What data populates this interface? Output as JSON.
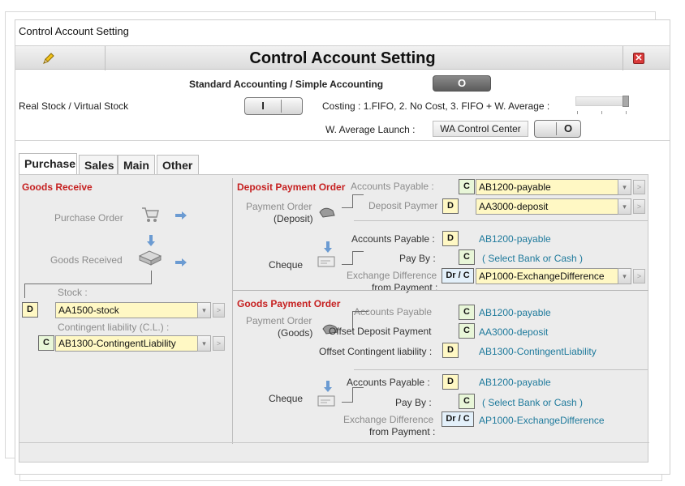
{
  "window": {
    "title": "Control Account Setting"
  },
  "header": {
    "title": "Control Account Setting",
    "pencil_icon": "pencil-icon",
    "close_icon": "close-icon"
  },
  "settings": {
    "accounting_mode_label": "Standard Accounting / Simple Accounting",
    "accounting_mode_value": "O",
    "stock_label": "Real Stock  / Virtual Stock",
    "stock_toggle_value": "I",
    "costing_label": "Costing : 1.FIFO,  2. No Cost,  3. FIFO + W. Average  :",
    "w_average_label": "W. Average Launch :",
    "wa_button": "WA Control Center",
    "w_average_toggle_value": "O"
  },
  "tabs": [
    {
      "label": "Purchase",
      "active": true
    },
    {
      "label": "Sales",
      "active": false
    },
    {
      "label": "Main",
      "active": false
    },
    {
      "label": "Other",
      "active": false
    }
  ],
  "goods_receive": {
    "title": "Goods Receive",
    "purchase_order": "Purchase Order",
    "goods_received": "Goods Received",
    "stock_label": "Stock :",
    "stock_code": "D",
    "stock_account": "AA1500-stock",
    "contingent_label": "Contingent liability (C.L.) :",
    "contingent_code": "C",
    "contingent_account": "AB1300-ContingentLiability"
  },
  "deposit_payment_order": {
    "title": "Deposit Payment Order",
    "payment_order": "Payment Order",
    "deposit": "(Deposit)",
    "accounts_payable_label": "Accounts Payable :",
    "accounts_payable_code": "C",
    "accounts_payable_account": "AB1200-payable",
    "deposit_payment_label": "Deposit Paymer",
    "deposit_payment_code": "D",
    "deposit_payment_account": "AA3000-deposit",
    "cheque": "Cheque",
    "cheque_ap_label": "Accounts Payable :",
    "cheque_ap_code": "D",
    "cheque_ap_account": "AB1200-payable",
    "pay_by_label": "Pay By :",
    "pay_by_code": "C",
    "pay_by_value": "( Select Bank or Cash )",
    "exchange_label": "Exchange Difference",
    "from_payment_label": "from Payment :",
    "exchange_code": "Dr / C",
    "exchange_account": "AP1000-ExchangeDifference"
  },
  "goods_payment_order": {
    "title": "Goods Payment Order",
    "payment_order": "Payment Order",
    "goods": "(Goods)",
    "accounts_payable_label": "Accounts Payable",
    "accounts_payable_code": "C",
    "accounts_payable_account": "AB1200-payable",
    "offset_deposit_label": "Offset Deposit Payment",
    "offset_deposit_code": "C",
    "offset_deposit_account": "AA3000-deposit",
    "offset_contingent_label": "Offset Contingent liability :",
    "offset_contingent_code": "D",
    "offset_contingent_account": "AB1300-ContingentLiability",
    "cheque": "Cheque",
    "cheque_ap_label": "Accounts Payable :",
    "cheque_ap_code": "D",
    "cheque_ap_account": "AB1200-payable",
    "pay_by_label": "Pay By :",
    "pay_by_code": "C",
    "pay_by_value": "( Select Bank or Cash )",
    "exchange_label": "Exchange Difference",
    "from_payment_label": "from Payment :",
    "exchange_code": "Dr / C",
    "exchange_account": "AP1000-ExchangeDifference"
  },
  "colors": {
    "section_title": "#c62121",
    "account_text": "#1f7a9c",
    "code_fill": "#fff8c4"
  }
}
